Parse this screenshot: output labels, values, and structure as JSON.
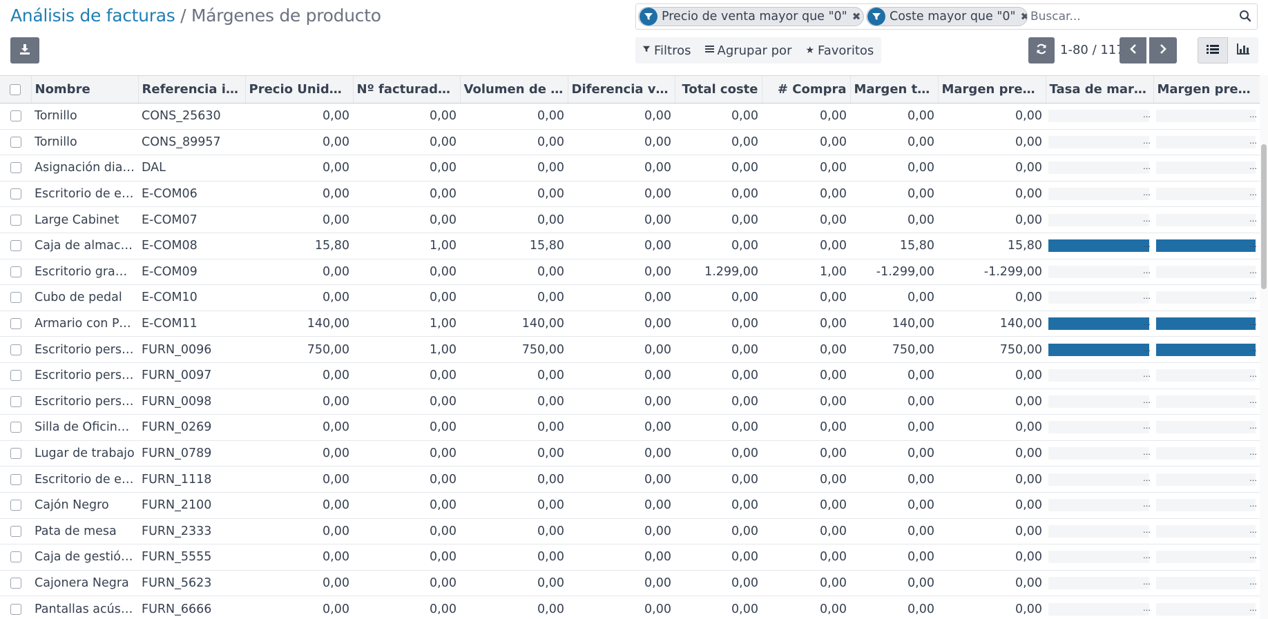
{
  "breadcrumb": {
    "parent": "Análisis de facturas",
    "separator": "/",
    "current": "Márgenes de producto"
  },
  "search": {
    "facets": [
      {
        "label": "Precio de venta mayor que \"0\"",
        "icon": "filter-icon"
      },
      {
        "label": "Coste mayor que \"0\"",
        "icon": "filter-icon"
      }
    ],
    "placeholder": "Buscar...",
    "value": ""
  },
  "toolbar": {
    "filters_label": "Filtros",
    "groupby_label": "Agrupar por",
    "favorites_label": "Favoritos"
  },
  "pager": {
    "value": "1-80 / 117"
  },
  "colors": {
    "accent": "#1f6fa6",
    "link": "#1f7fb3",
    "button": "#6b7280"
  },
  "table": {
    "columns": [
      "Nombre",
      "Referencia interna",
      "Precio Unidad de venta",
      "Nº facturado en venta",
      "Volumen de negocio",
      "Diferencia venta",
      "Total coste",
      "# Compra",
      "Margen total",
      "Margen previsto",
      "Tasa de margen",
      "Margen previsto"
    ],
    "rows": [
      {
        "name": "Tornillo",
        "ref": "CONS_25630",
        "price": "0,00",
        "qty": "0,00",
        "turnover": "0,00",
        "diff": "0,00",
        "cost": "0,00",
        "purchase": "0,00",
        "margin": "0,00",
        "expected": "0,00",
        "rate": 0,
        "expected_rate": 0
      },
      {
        "name": "Tornillo",
        "ref": "CONS_89957",
        "price": "0,00",
        "qty": "0,00",
        "turnover": "0,00",
        "diff": "0,00",
        "cost": "0,00",
        "purchase": "0,00",
        "margin": "0,00",
        "expected": "0,00",
        "rate": 0,
        "expected_rate": 0
      },
      {
        "name": "Asignación diaria",
        "ref": "DAL",
        "price": "0,00",
        "qty": "0,00",
        "turnover": "0,00",
        "diff": "0,00",
        "cost": "0,00",
        "purchase": "0,00",
        "margin": "0,00",
        "expected": "0,00",
        "rate": 0,
        "expected_rate": 0
      },
      {
        "name": "Escritorio de esquina",
        "ref": "E-COM06",
        "price": "0,00",
        "qty": "0,00",
        "turnover": "0,00",
        "diff": "0,00",
        "cost": "0,00",
        "purchase": "0,00",
        "margin": "0,00",
        "expected": "0,00",
        "rate": 0,
        "expected_rate": 0
      },
      {
        "name": "Large Cabinet",
        "ref": "E-COM07",
        "price": "0,00",
        "qty": "0,00",
        "turnover": "0,00",
        "diff": "0,00",
        "cost": "0,00",
        "purchase": "0,00",
        "margin": "0,00",
        "expected": "0,00",
        "rate": 0,
        "expected_rate": 0
      },
      {
        "name": "Caja de almacenaje",
        "ref": "E-COM08",
        "price": "15,80",
        "qty": "1,00",
        "turnover": "15,80",
        "diff": "0,00",
        "cost": "0,00",
        "purchase": "0,00",
        "margin": "15,80",
        "expected": "15,80",
        "rate": 100,
        "expected_rate": 100
      },
      {
        "name": "Escritorio grande",
        "ref": "E-COM09",
        "price": "0,00",
        "qty": "0,00",
        "turnover": "0,00",
        "diff": "0,00",
        "cost": "1.299,00",
        "purchase": "1,00",
        "margin": "-1.299,00",
        "expected": "-1.299,00",
        "rate": 0,
        "expected_rate": 0
      },
      {
        "name": "Cubo de pedal",
        "ref": "E-COM10",
        "price": "0,00",
        "qty": "0,00",
        "turnover": "0,00",
        "diff": "0,00",
        "cost": "0,00",
        "purchase": "0,00",
        "margin": "0,00",
        "expected": "0,00",
        "rate": 0,
        "expected_rate": 0
      },
      {
        "name": "Armario con Puertas",
        "ref": "E-COM11",
        "price": "140,00",
        "qty": "1,00",
        "turnover": "140,00",
        "diff": "0,00",
        "cost": "0,00",
        "purchase": "0,00",
        "margin": "140,00",
        "expected": "140,00",
        "rate": 100,
        "expected_rate": 100
      },
      {
        "name": "Escritorio personalizable",
        "ref": "FURN_0096",
        "price": "750,00",
        "qty": "1,00",
        "turnover": "750,00",
        "diff": "0,00",
        "cost": "0,00",
        "purchase": "0,00",
        "margin": "750,00",
        "expected": "750,00",
        "rate": 100,
        "expected_rate": 100
      },
      {
        "name": "Escritorio personalizable",
        "ref": "FURN_0097",
        "price": "0,00",
        "qty": "0,00",
        "turnover": "0,00",
        "diff": "0,00",
        "cost": "0,00",
        "purchase": "0,00",
        "margin": "0,00",
        "expected": "0,00",
        "rate": 0,
        "expected_rate": 0
      },
      {
        "name": "Escritorio personalizable",
        "ref": "FURN_0098",
        "price": "0,00",
        "qty": "0,00",
        "turnover": "0,00",
        "diff": "0,00",
        "cost": "0,00",
        "purchase": "0,00",
        "margin": "0,00",
        "expected": "0,00",
        "rate": 0,
        "expected_rate": 0
      },
      {
        "name": "Silla de Oficina Negra",
        "ref": "FURN_0269",
        "price": "0,00",
        "qty": "0,00",
        "turnover": "0,00",
        "diff": "0,00",
        "cost": "0,00",
        "purchase": "0,00",
        "margin": "0,00",
        "expected": "0,00",
        "rate": 0,
        "expected_rate": 0
      },
      {
        "name": "Lugar de trabajo",
        "ref": "FURN_0789",
        "price": "0,00",
        "qty": "0,00",
        "turnover": "0,00",
        "diff": "0,00",
        "cost": "0,00",
        "purchase": "0,00",
        "margin": "0,00",
        "expected": "0,00",
        "rate": 0,
        "expected_rate": 0
      },
      {
        "name": "Escritorio de esquina",
        "ref": "FURN_1118",
        "price": "0,00",
        "qty": "0,00",
        "turnover": "0,00",
        "diff": "0,00",
        "cost": "0,00",
        "purchase": "0,00",
        "margin": "0,00",
        "expected": "0,00",
        "rate": 0,
        "expected_rate": 0
      },
      {
        "name": "Cajón Negro",
        "ref": "FURN_2100",
        "price": "0,00",
        "qty": "0,00",
        "turnover": "0,00",
        "diff": "0,00",
        "cost": "0,00",
        "purchase": "0,00",
        "margin": "0,00",
        "expected": "0,00",
        "rate": 0,
        "expected_rate": 0
      },
      {
        "name": "Pata de mesa",
        "ref": "FURN_2333",
        "price": "0,00",
        "qty": "0,00",
        "turnover": "0,00",
        "diff": "0,00",
        "cost": "0,00",
        "purchase": "0,00",
        "margin": "0,00",
        "expected": "0,00",
        "rate": 0,
        "expected_rate": 0
      },
      {
        "name": "Caja de gestión de cables",
        "ref": "FURN_5555",
        "price": "0,00",
        "qty": "0,00",
        "turnover": "0,00",
        "diff": "0,00",
        "cost": "0,00",
        "purchase": "0,00",
        "margin": "0,00",
        "expected": "0,00",
        "rate": 0,
        "expected_rate": 0
      },
      {
        "name": "Cajonera Negra",
        "ref": "FURN_5623",
        "price": "0,00",
        "qty": "0,00",
        "turnover": "0,00",
        "diff": "0,00",
        "cost": "0,00",
        "purchase": "0,00",
        "margin": "0,00",
        "expected": "0,00",
        "rate": 0,
        "expected_rate": 0
      },
      {
        "name": "Pantallas acústicas",
        "ref": "FURN_6666",
        "price": "0,00",
        "qty": "0,00",
        "turnover": "0,00",
        "diff": "0,00",
        "cost": "0,00",
        "purchase": "0,00",
        "margin": "0,00",
        "expected": "0,00",
        "rate": 0,
        "expected_rate": 0
      }
    ]
  }
}
